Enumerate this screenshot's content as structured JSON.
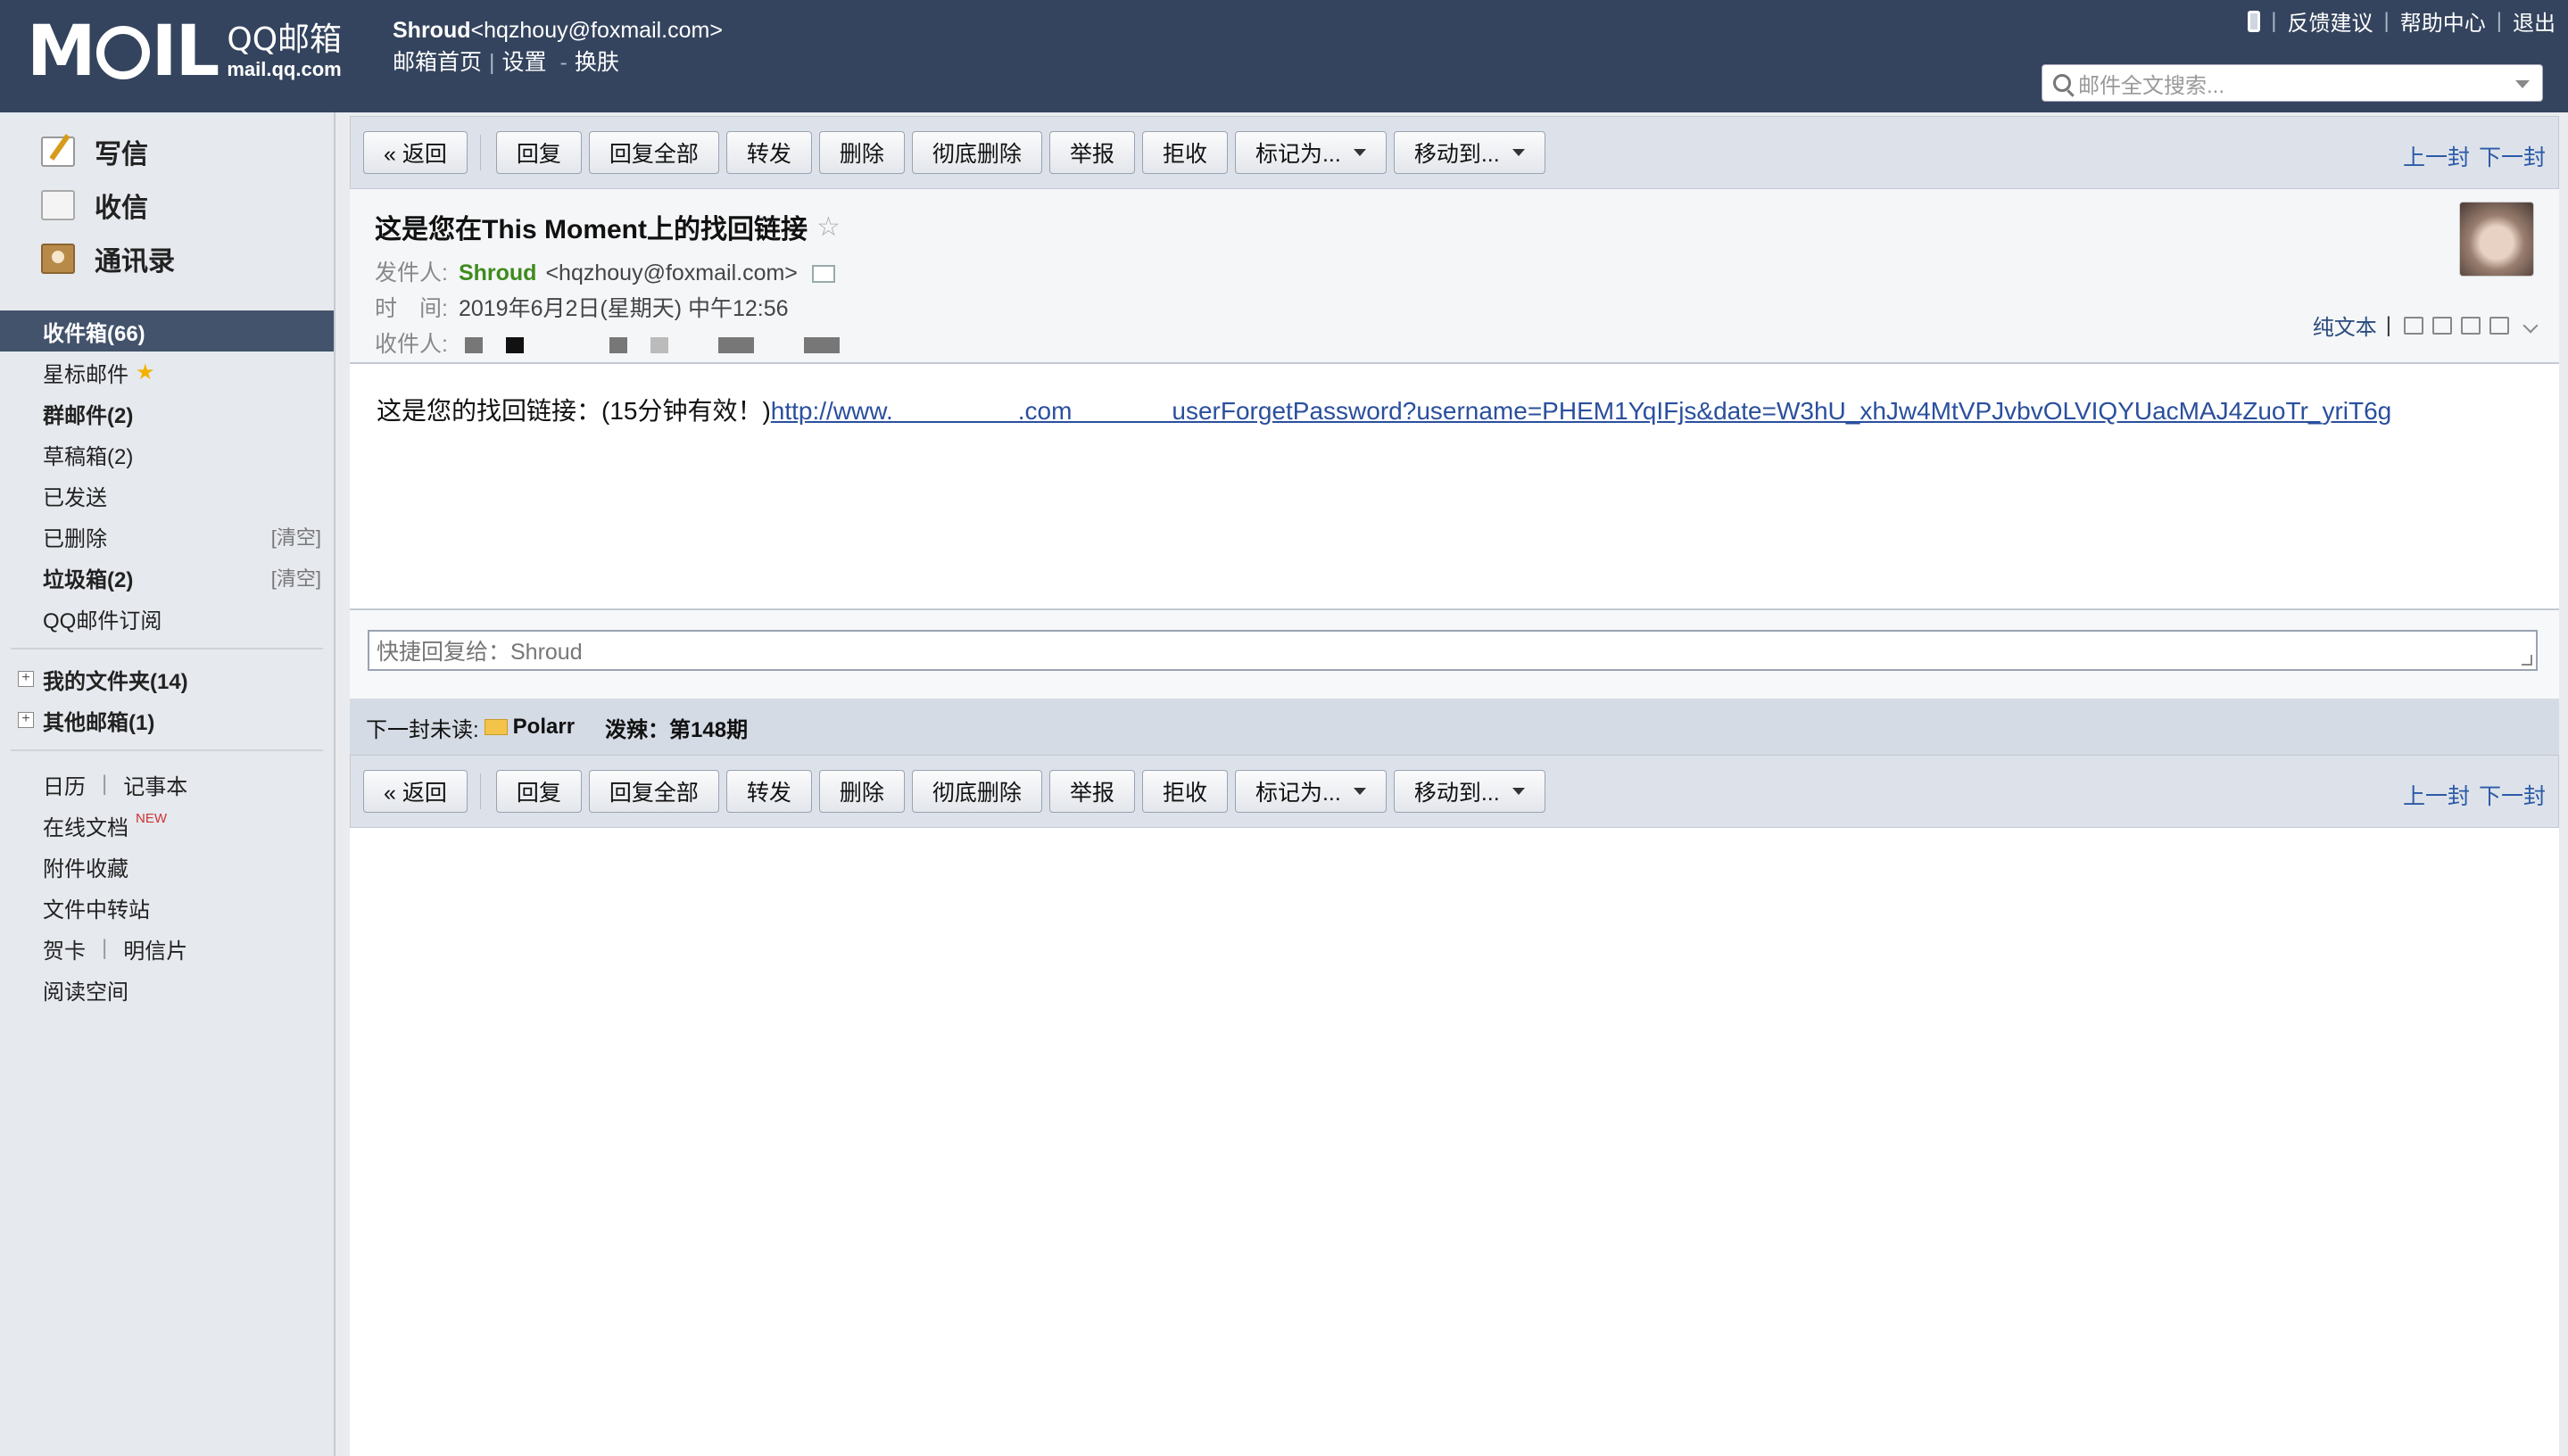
{
  "header": {
    "logo_mark": "MOIL",
    "logo_cn": "QQ邮箱",
    "logo_domain": "mail.qq.com",
    "user_name": "Shroud",
    "user_email": "<hqzhouy@foxmail.com>",
    "links": {
      "home": "邮箱首页",
      "settings": "设置",
      "dash": "-",
      "skin": "换肤"
    },
    "top_links": {
      "feedback": "反馈建议",
      "help": "帮助中心",
      "logout": "退出"
    },
    "search_placeholder": "邮件全文搜索..."
  },
  "sidebar": {
    "actions": {
      "compose": "写信",
      "inbox": "收信",
      "contacts": "通讯录"
    },
    "folders": [
      {
        "label": "收件箱(66)"
      },
      {
        "label": "星标邮件"
      },
      {
        "label": "群邮件(2)"
      },
      {
        "label": "草稿箱(2)"
      },
      {
        "label": "已发送"
      },
      {
        "label": "已删除",
        "action": "[清空]"
      },
      {
        "label": "垃圾箱(2)",
        "action": "[清空]"
      },
      {
        "label": "QQ邮件订阅"
      }
    ],
    "trees": [
      {
        "label": "我的文件夹(14)"
      },
      {
        "label": "其他邮箱(1)"
      }
    ],
    "tools": {
      "calendar": "日历",
      "notes": "记事本",
      "docs": "在线文档",
      "docs_badge": "NEW",
      "attachments": "附件收藏",
      "transfer": "文件中转站",
      "cards": "贺卡",
      "postcards": "明信片",
      "reading": "阅读空间"
    }
  },
  "toolbar": {
    "back": "« 返回",
    "reply": "回复",
    "reply_all": "回复全部",
    "forward": "转发",
    "delete": "删除",
    "delete_perm": "彻底删除",
    "report": "举报",
    "reject": "拒收",
    "mark_as": "标记为...",
    "move_to": "移动到...",
    "prev": "上一封",
    "next": "下一封"
  },
  "mail": {
    "subject": "这是您在This Moment上的找回链接",
    "sender_label": "发件人:",
    "sender_name": "Shroud",
    "sender_email": "<hqzhouy@foxmail.com>",
    "time_label": "时　间:",
    "time": "2019年6月2日(星期天) 中午12:56",
    "recipient_label": "收件人:",
    "plain_text": "纯文本",
    "body_prefix": "这是您的找回链接：(15分钟有效！)",
    "body_link": "http://www.     .com    userForgetPassword?username=PHEM1YqIFjs&date=W3hU_xhJw4MtVPJvbvOLVIQYUacMAJ4ZuoTr_yriT6g"
  },
  "reply": {
    "placeholder": "快捷回复给：Shroud"
  },
  "next_unread": {
    "label": "下一封未读:",
    "from": "Polarr",
    "title": "泼辣：第148期"
  }
}
